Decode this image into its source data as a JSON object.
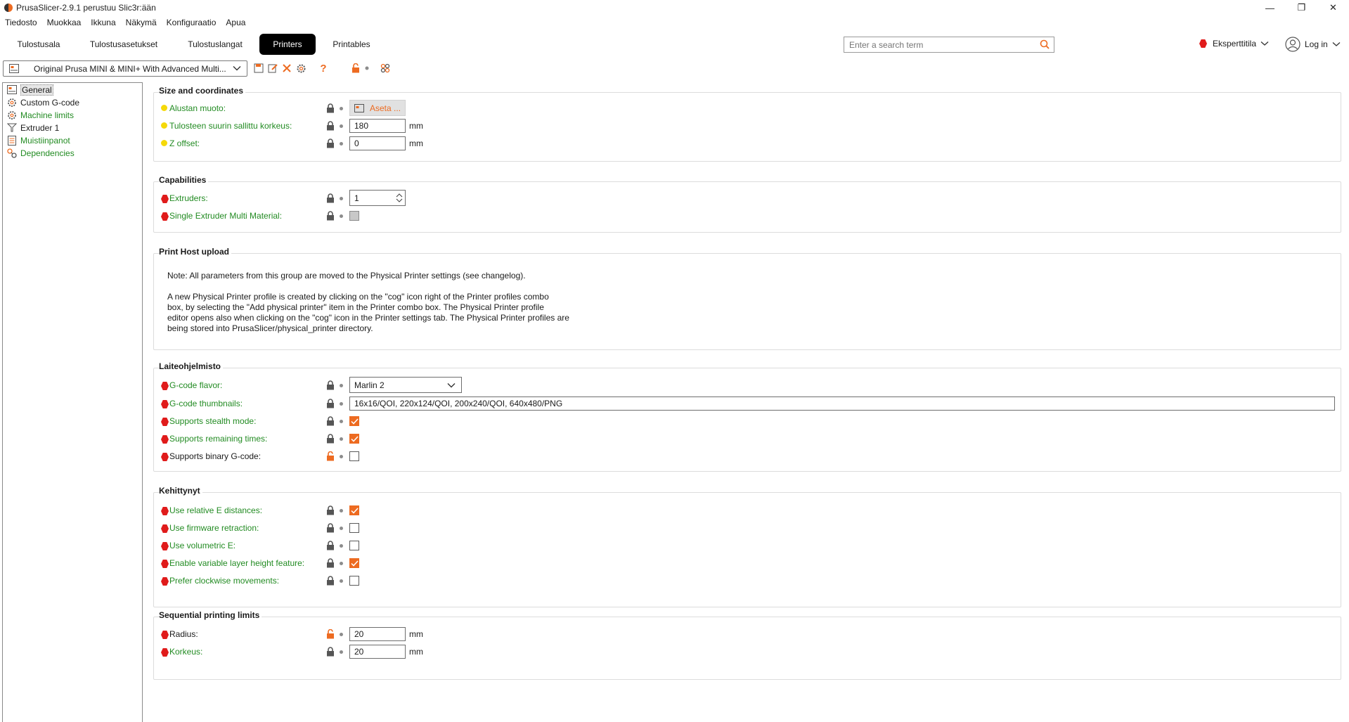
{
  "window": {
    "title": "PrusaSlicer-2.9.1 perustuu Slic3r:ään",
    "minimize": "—",
    "maximize": "❐",
    "close": "✕"
  },
  "menu": [
    "Tiedosto",
    "Muokkaa",
    "Ikkuna",
    "Näkymä",
    "Konfiguraatio",
    "Apua"
  ],
  "tabs": [
    {
      "label": "Tulostusala",
      "active": false
    },
    {
      "label": "Tulostusasetukset",
      "active": false
    },
    {
      "label": "Tulostuslangat",
      "active": false
    },
    {
      "label": "Printers",
      "active": true
    },
    {
      "label": "Printables",
      "active": false
    }
  ],
  "search": {
    "placeholder": "Enter a search term"
  },
  "mode": {
    "label": "Eksperttitila"
  },
  "login": {
    "label": "Log in"
  },
  "preset": {
    "label": "Original Prusa MINI & MINI+ With Advanced Multi..."
  },
  "sidebar": [
    {
      "label": "General",
      "color": "normal",
      "icon": "printer-icon"
    },
    {
      "label": "Custom G-code",
      "color": "normal",
      "icon": "cog-icon"
    },
    {
      "label": "Machine limits",
      "color": "green",
      "icon": "cog-icon"
    },
    {
      "label": "Extruder 1",
      "color": "normal",
      "icon": "funnel-icon"
    },
    {
      "label": "Muistiinpanot",
      "color": "green",
      "icon": "note-icon"
    },
    {
      "label": "Dependencies",
      "color": "green",
      "icon": "dependency-icon"
    }
  ],
  "groups": {
    "size": {
      "title": "Size and coordinates",
      "bed_shape": {
        "label": "Alustan muoto:",
        "button": "Aseta ..."
      },
      "max_height": {
        "label": "Tulosteen suurin sallittu korkeus:",
        "value": "180",
        "unit": "mm"
      },
      "z_offset": {
        "label": "Z offset:",
        "value": "0",
        "unit": "mm"
      }
    },
    "capabilities": {
      "title": "Capabilities",
      "extruders": {
        "label": "Extruders:",
        "value": "1"
      },
      "semm": {
        "label": "Single Extruder Multi Material:"
      }
    },
    "host": {
      "title": "Print Host upload",
      "note1": "Note: All parameters from this group are moved to the Physical Printer settings (see changelog).",
      "note2": "A new Physical Printer profile is created by clicking on the \"cog\" icon right of the Printer profiles combo\nbox, by selecting the \"Add physical printer\" item in the Printer combo box. The Physical Printer profile\neditor opens also when clicking on the \"cog\" icon in the Printer settings tab. The Physical Printer profiles are\nbeing stored into PrusaSlicer/physical_printer directory."
    },
    "firmware": {
      "title": "Laiteohjelmisto",
      "flavor": {
        "label": "G-code flavor:",
        "value": "Marlin 2"
      },
      "thumbnails": {
        "label": "G-code thumbnails:",
        "value": "16x16/QOI, 220x124/QOI, 200x240/QOI, 640x480/PNG"
      },
      "stealth": {
        "label": "Supports stealth mode:",
        "checked": true
      },
      "remaining": {
        "label": "Supports remaining times:",
        "checked": true
      },
      "binary": {
        "label": "Supports binary G-code:",
        "checked": false
      }
    },
    "advanced": {
      "title": "Kehittynyt",
      "relative_e": {
        "label": "Use relative E distances:",
        "checked": true
      },
      "fw_retract": {
        "label": "Use firmware retraction:",
        "checked": false
      },
      "volumetric": {
        "label": "Use volumetric E:",
        "checked": false
      },
      "variable_layer": {
        "label": "Enable variable layer height feature:",
        "checked": true
      },
      "clockwise": {
        "label": "Prefer clockwise movements:",
        "checked": false
      }
    },
    "sequential": {
      "title": "Sequential printing limits",
      "radius": {
        "label": "Radius:",
        "value": "20",
        "unit": "mm"
      },
      "height": {
        "label": "Korkeus:",
        "value": "20",
        "unit": "mm"
      }
    }
  },
  "colors": {
    "accent": "#ed6b21",
    "green": "#228b22",
    "red": "#e01b1b",
    "yellow": "#f5d90a"
  }
}
